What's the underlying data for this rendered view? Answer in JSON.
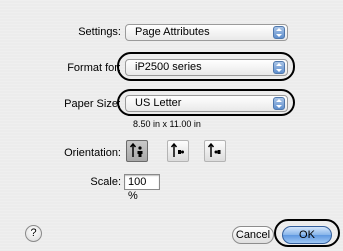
{
  "settings": {
    "label": "Settings:",
    "value": "Page Attributes"
  },
  "format_for": {
    "label": "Format for:",
    "value": "iP2500 series"
  },
  "paper_size": {
    "label": "Paper Size:",
    "value": "US Letter",
    "dimensions": "8.50 in x 11.00 in"
  },
  "orientation": {
    "label": "Orientation:",
    "options": [
      {
        "name": "portrait",
        "selected": true
      },
      {
        "name": "landscape-left",
        "selected": false
      },
      {
        "name": "landscape-right",
        "selected": false
      }
    ]
  },
  "scale": {
    "label": "Scale:",
    "value": "100 %"
  },
  "buttons": {
    "help": "?",
    "cancel": "Cancel",
    "ok": "OK"
  },
  "colors": {
    "default_button": "#6fa4e6",
    "popup_arrows": "#6f98cf",
    "annotation_outline": "#000000"
  }
}
